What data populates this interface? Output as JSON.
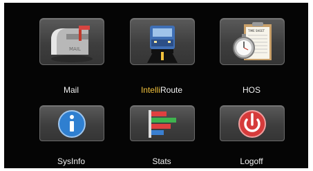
{
  "apps": [
    {
      "id": "mail",
      "label": "Mail",
      "icon": "mailbox-icon"
    },
    {
      "id": "intelliroute",
      "label_prefix": "Intelli",
      "label_suffix": "Route",
      "icon": "truck-road-icon",
      "prefix_color": "#f2c23c"
    },
    {
      "id": "hos",
      "label": "HOS",
      "icon": "stopwatch-clipboard-icon"
    },
    {
      "id": "sysinfo",
      "label": "SysInfo",
      "icon": "info-icon"
    },
    {
      "id": "stats",
      "label": "Stats",
      "icon": "bar-chart-icon"
    },
    {
      "id": "logoff",
      "label": "Logoff",
      "icon": "power-icon"
    }
  ],
  "mail_tile_text": "MAIL",
  "hos_tile_text": "TIME SHEET"
}
